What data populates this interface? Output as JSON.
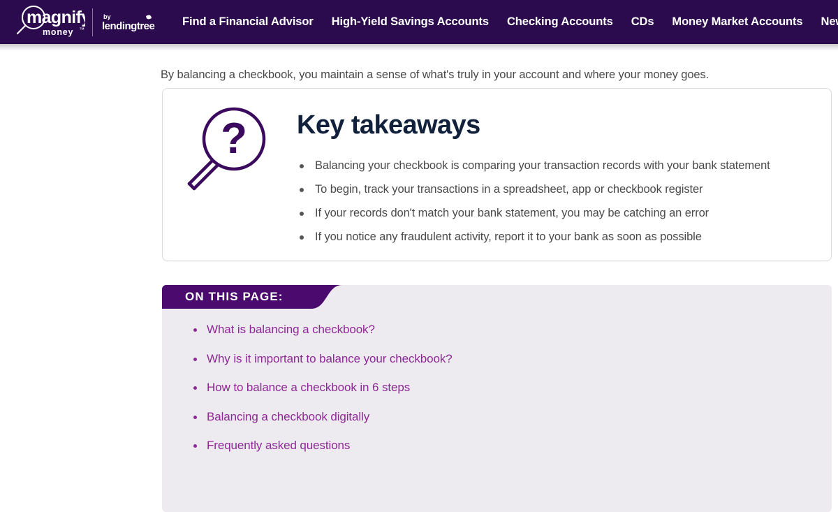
{
  "brand": {
    "name": "magnify money",
    "wordmark": "magnify",
    "sub_wordmark": "money",
    "trademark": "™",
    "by_label": "by",
    "partner": "lendingtree",
    "logo_icon": "magnifying-glass-icon"
  },
  "nav": {
    "items": [
      {
        "label": "Find a Financial Advisor"
      },
      {
        "label": "High-Yield Savings Accounts"
      },
      {
        "label": "Checking Accounts"
      },
      {
        "label": "CDs"
      },
      {
        "label": "Money Market Accounts"
      },
      {
        "label": "News"
      }
    ]
  },
  "article": {
    "intro": "By balancing a checkbook, you maintain a sense of what's truly in your account and where your money goes."
  },
  "takeaways": {
    "icon": "magnifying-glass-question-icon",
    "title": "Key takeaways",
    "items": [
      "Balancing your checkbook is comparing your transaction records with your bank statement",
      "To begin, track your transactions in a spreadsheet, app or checkbook register",
      "If your records don't match your bank statement, you may be catching an error",
      "If you notice any fraudulent activity, report it to your bank as soon as possible"
    ]
  },
  "on_this_page": {
    "ribbon_label": "ON THIS PAGE:",
    "links": [
      {
        "label": "What is balancing a checkbook?"
      },
      {
        "label": "Why is it important to balance your checkbook?"
      },
      {
        "label": "How to balance a checkbook in 6 steps"
      },
      {
        "label": "Balancing a checkbook digitally"
      },
      {
        "label": "Frequently asked questions"
      }
    ]
  },
  "colors": {
    "nav_purple": "#2B0A4D",
    "ribbon_purple": "#4B0A6E",
    "link_purple": "#8E2896",
    "heading_navy": "#11213C",
    "body_gray": "#4A4A4A",
    "panel_bg": "#EDEBF0",
    "card_border": "#DCDCDC"
  }
}
